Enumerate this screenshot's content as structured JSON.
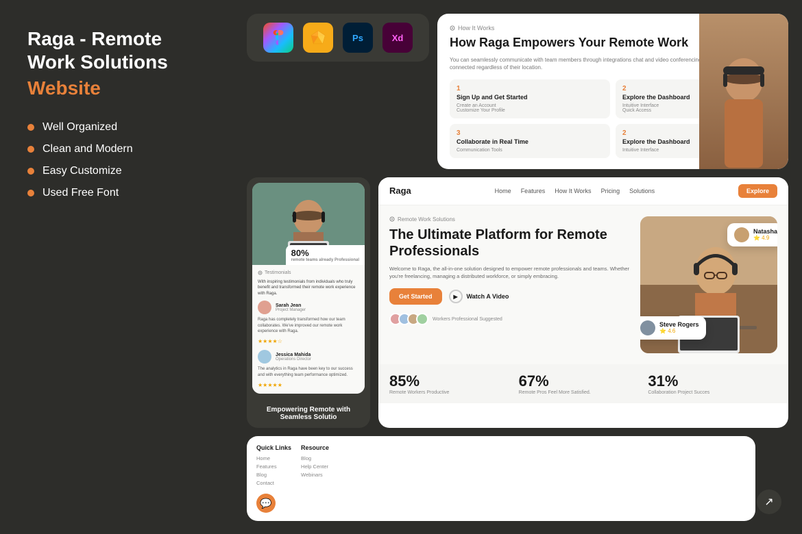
{
  "left": {
    "title": "Raga - Remote Work Solutions",
    "subtitle": "Website",
    "features": [
      "Well Organized",
      "Clean and Modern",
      "Easy Customize",
      "Used Free Font"
    ]
  },
  "tools": {
    "figma_label": "F",
    "sketch_label": "◆",
    "ps_label": "Ps",
    "xd_label": "Xd"
  },
  "how_it_works": {
    "section_label": "How It Works",
    "title": "How Raga Empowers Your Remote Work",
    "description": "You can seamlessly communicate with team members through integrations chat and video conferencing, ensuring that everyone stays connected regardless of their location.",
    "steps": [
      {
        "num": "1",
        "title": "Sign Up and Get Started",
        "items": [
          "Create an Account",
          "Customize Your Profile"
        ]
      },
      {
        "num": "2",
        "title": "Explore the Dashboard",
        "items": [
          "Intuitive Interface",
          "Quick Access"
        ]
      },
      {
        "num": "3",
        "title": "Collaborate in Real Time",
        "items": [
          "Communication Tools"
        ]
      },
      {
        "num": "2",
        "title": "Explore the Dashboard",
        "items": [
          "Intuitive Interface"
        ]
      }
    ]
  },
  "site_nav": {
    "logo": "Raga",
    "links": [
      "Home",
      "Features",
      "How It Works",
      "Pricing",
      "Solutions"
    ],
    "cta": "Explore"
  },
  "hero": {
    "label": "Remote Work Solutions",
    "title": "The Ultimate Platform for Remote Professionals",
    "description": "Welcome to Raga, the all-in-one solution designed to empower remote professionals and teams. Whether you're freelancing, managing a distributed workforce, or simply embracing.",
    "cta_primary": "Get Started",
    "cta_secondary": "Watch A Video",
    "workers_label": "Workers Professional Suggested"
  },
  "stats": [
    {
      "num": "85%",
      "label": "Remote Workers Productive"
    },
    {
      "num": "67%",
      "label": "Remote Pros Feel More Satisfied."
    },
    {
      "num": "31%",
      "label": "Collaboration Project Succes"
    }
  ],
  "floating_cards": [
    {
      "name": "Natasha",
      "rating": "4.9"
    },
    {
      "name": "Steve Rogers",
      "rating": "4.6"
    }
  ],
  "testimonials": {
    "label": "Testimonials",
    "users": [
      {
        "name": "Sarah Jean",
        "role": "Project Manager",
        "text": "Raga has completely transformed how our team collaborates. We've improved our remote work experience with Raga.",
        "stars": "★★★★☆"
      },
      {
        "name": "Jessica Mahida",
        "role": "Operations Director",
        "text": "The analytics in Raga have been key to our success and with everything team performance optimized.",
        "stars": "★★★★★"
      }
    ]
  },
  "mobile_progress": {
    "value": "80%",
    "label": "remote teams already Professional"
  },
  "mobile_bottom_label": "Empowering Remote with Seamless Solutio",
  "footer": {
    "quick_links_title": "Quick Links",
    "quick_links": [
      "Home",
      "Features",
      "Blog",
      "Contact"
    ],
    "resource_title": "Resource",
    "resources": [
      "Blog",
      "Help Center",
      "Webinars"
    ]
  }
}
